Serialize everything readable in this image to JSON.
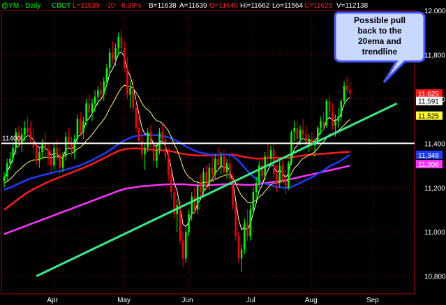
{
  "header": {
    "symbol": "@YM - Daily",
    "exchange": "CBOT",
    "last": "L=11639",
    "change": "-10",
    "change_pct": "-0.09%",
    "bid": "B=11638",
    "ask": "A=11639",
    "open": "O=11640",
    "high": "Hi=11662",
    "low": "Lo=11564",
    "close": "C=11625",
    "volume": "V=112138"
  },
  "colors": {
    "background": "#000000",
    "up_candle": "#00ff00",
    "down_candle": "#ff0000",
    "ema_fast": "#ffffff",
    "ema_20": "#ffff66",
    "ma_blue": "#1e3cff",
    "ma_red": "#ff1a1a",
    "ma_magenta": "#ff33ff",
    "trendline": "#33ee88",
    "horizontal": "#ffffff",
    "callout_fill": "#c9d8ff",
    "callout_border": "#5566ff",
    "grid": "#b00000"
  },
  "chart_data": {
    "type": "candlestick",
    "y_axis": {
      "min": 10720,
      "max": 12000,
      "ticks": [
        "12,000",
        "11,800",
        "11,600",
        "11,400",
        "11,200",
        "11,000",
        "10,800"
      ],
      "tick_values": [
        12000,
        11800,
        11600,
        11400,
        11200,
        11000,
        10800
      ]
    },
    "x_axis": {
      "labels": [
        "Apr",
        "May",
        "Jun",
        "Jul",
        "Aug",
        "Sep"
      ],
      "label_index": [
        17,
        41,
        63,
        85,
        105,
        126
      ]
    },
    "grid": true,
    "candles": [
      [
        11230,
        11270,
        11200,
        11250
      ],
      [
        11250,
        11330,
        11230,
        11310
      ],
      [
        11310,
        11360,
        11280,
        11330
      ],
      [
        11330,
        11400,
        11310,
        11380
      ],
      [
        11380,
        11470,
        11350,
        11450
      ],
      [
        11450,
        11480,
        11380,
        11400
      ],
      [
        11400,
        11470,
        11360,
        11440
      ],
      [
        11440,
        11500,
        11410,
        11470
      ],
      [
        11470,
        11520,
        11430,
        11450
      ],
      [
        11450,
        11500,
        11400,
        11420
      ],
      [
        11420,
        11470,
        11350,
        11380
      ],
      [
        11380,
        11400,
        11300,
        11320
      ],
      [
        11320,
        11380,
        11290,
        11360
      ],
      [
        11360,
        11420,
        11330,
        11400
      ],
      [
        11400,
        11450,
        11340,
        11370
      ],
      [
        11370,
        11400,
        11300,
        11330
      ],
      [
        11330,
        11370,
        11270,
        11300
      ],
      [
        11300,
        11400,
        11280,
        11380
      ],
      [
        11380,
        11420,
        11320,
        11350
      ],
      [
        11350,
        11380,
        11260,
        11290
      ],
      [
        11290,
        11360,
        11270,
        11340
      ],
      [
        11340,
        11450,
        11320,
        11430
      ],
      [
        11430,
        11470,
        11380,
        11400
      ],
      [
        11400,
        11430,
        11340,
        11360
      ],
      [
        11360,
        11440,
        11330,
        11420
      ],
      [
        11420,
        11530,
        11400,
        11510
      ],
      [
        11510,
        11540,
        11430,
        11450
      ],
      [
        11450,
        11520,
        11420,
        11500
      ],
      [
        11500,
        11600,
        11480,
        11580
      ],
      [
        11580,
        11620,
        11520,
        11540
      ],
      [
        11540,
        11600,
        11500,
        11580
      ],
      [
        11580,
        11640,
        11540,
        11610
      ],
      [
        11610,
        11660,
        11570,
        11640
      ],
      [
        11640,
        11680,
        11600,
        11620
      ],
      [
        11620,
        11700,
        11590,
        11680
      ],
      [
        11680,
        11760,
        11660,
        11740
      ],
      [
        11740,
        11830,
        11720,
        11810
      ],
      [
        11810,
        11860,
        11760,
        11780
      ],
      [
        11780,
        11850,
        11750,
        11830
      ],
      [
        11830,
        11900,
        11800,
        11880
      ],
      [
        11880,
        11910,
        11810,
        11830
      ],
      [
        11830,
        11860,
        11720,
        11740
      ],
      [
        11740,
        11790,
        11600,
        11620
      ],
      [
        11620,
        11680,
        11560,
        11650
      ],
      [
        11650,
        11690,
        11540,
        11560
      ],
      [
        11560,
        11600,
        11450,
        11470
      ],
      [
        11470,
        11530,
        11390,
        11410
      ],
      [
        11410,
        11460,
        11320,
        11350
      ],
      [
        11350,
        11400,
        11280,
        11380
      ],
      [
        11380,
        11470,
        11360,
        11450
      ],
      [
        11450,
        11480,
        11380,
        11400
      ],
      [
        11400,
        11420,
        11300,
        11320
      ],
      [
        11320,
        11400,
        11290,
        11370
      ],
      [
        11370,
        11470,
        11350,
        11450
      ],
      [
        11450,
        11490,
        11400,
        11420
      ],
      [
        11420,
        11440,
        11320,
        11340
      ],
      [
        11340,
        11380,
        11230,
        11260
      ],
      [
        11260,
        11300,
        11150,
        11180
      ],
      [
        11180,
        11200,
        11060,
        11080
      ],
      [
        11080,
        11150,
        11000,
        11120
      ],
      [
        11120,
        11140,
        10940,
        10960
      ],
      [
        10960,
        11000,
        10840,
        10880
      ],
      [
        10880,
        11020,
        10860,
        11000
      ],
      [
        11000,
        11100,
        10980,
        11080
      ],
      [
        11080,
        11180,
        11050,
        11160
      ],
      [
        11160,
        11200,
        11080,
        11100
      ],
      [
        11100,
        11230,
        11080,
        11210
      ],
      [
        11210,
        11260,
        11160,
        11180
      ],
      [
        11180,
        11290,
        11160,
        11270
      ],
      [
        11270,
        11300,
        11190,
        11210
      ],
      [
        11210,
        11310,
        11190,
        11290
      ],
      [
        11290,
        11340,
        11240,
        11260
      ],
      [
        11260,
        11350,
        11240,
        11330
      ],
      [
        11330,
        11380,
        11280,
        11300
      ],
      [
        11300,
        11360,
        11260,
        11340
      ],
      [
        11340,
        11370,
        11250,
        11270
      ],
      [
        11270,
        11330,
        11240,
        11310
      ],
      [
        11310,
        11350,
        11220,
        11240
      ],
      [
        11240,
        11260,
        11100,
        11120
      ],
      [
        11120,
        11130,
        10960,
        10980
      ],
      [
        10980,
        11000,
        10860,
        10880
      ],
      [
        10880,
        10940,
        10820,
        10920
      ],
      [
        10920,
        11060,
        10900,
        11040
      ],
      [
        11040,
        11100,
        10960,
        10980
      ],
      [
        10980,
        11120,
        10960,
        11100
      ],
      [
        11100,
        11200,
        11080,
        11180
      ],
      [
        11180,
        11250,
        11140,
        11220
      ],
      [
        11220,
        11320,
        11200,
        11300
      ],
      [
        11300,
        11340,
        11220,
        11250
      ],
      [
        11250,
        11360,
        11230,
        11340
      ],
      [
        11340,
        11400,
        11300,
        11330
      ],
      [
        11330,
        11390,
        11290,
        11370
      ],
      [
        11370,
        11400,
        11240,
        11260
      ],
      [
        11260,
        11300,
        11180,
        11220
      ],
      [
        11220,
        11320,
        11200,
        11300
      ],
      [
        11300,
        11340,
        11220,
        11240
      ],
      [
        11240,
        11280,
        11170,
        11200
      ],
      [
        11200,
        11320,
        11190,
        11310
      ],
      [
        11310,
        11460,
        11300,
        11450
      ],
      [
        11450,
        11500,
        11410,
        11470
      ],
      [
        11470,
        11500,
        11380,
        11420
      ],
      [
        11420,
        11480,
        11390,
        11460
      ],
      [
        11460,
        11510,
        11420,
        11440
      ],
      [
        11440,
        11480,
        11380,
        11400
      ],
      [
        11400,
        11440,
        11360,
        11420
      ],
      [
        11420,
        11450,
        11370,
        11390
      ],
      [
        11390,
        11420,
        11340,
        11410
      ],
      [
        11410,
        11480,
        11390,
        11470
      ],
      [
        11470,
        11520,
        11440,
        11500
      ],
      [
        11500,
        11540,
        11460,
        11480
      ],
      [
        11480,
        11600,
        11470,
        11590
      ],
      [
        11590,
        11620,
        11520,
        11540
      ],
      [
        11540,
        11580,
        11460,
        11480
      ],
      [
        11480,
        11530,
        11430,
        11500
      ],
      [
        11500,
        11560,
        11470,
        11520
      ],
      [
        11520,
        11600,
        11500,
        11590
      ],
      [
        11590,
        11680,
        11570,
        11660
      ],
      [
        11660,
        11700,
        11620,
        11640
      ],
      [
        11640,
        11680,
        11600,
        11625
      ]
    ],
    "ema_fast": [
      11240,
      11270,
      11300,
      11330,
      11380,
      11390,
      11405,
      11425,
      11435,
      11430,
      11415,
      11390,
      11380,
      11385,
      11380,
      11365,
      11345,
      11355,
      11352,
      11335,
      11337,
      11370,
      11380,
      11373,
      11388,
      11430,
      11437,
      11458,
      11500,
      11513,
      11535,
      11560,
      11587,
      11598,
      11626,
      11664,
      11713,
      11736,
      11767,
      11805,
      11813,
      11789,
      11733,
      11705,
      11657,
      11594,
      11533,
      11472,
      11441,
      11444,
      11429,
      11393,
      11385,
      11406,
      11411,
      11387,
      11345,
      11290,
      11220,
      11187,
      11112,
      11035,
      11024,
      11043,
      11082,
      11088,
      11129,
      11146,
      11187,
      11195,
      11226,
      11237,
      11268,
      11279,
      11299,
      11289,
      11296,
      11277,
      11225,
      11143,
      11055,
      11010,
      11020,
      11007,
      11038,
      11085,
      11130,
      11187,
      11208,
      11252,
      11278,
      11309,
      11293,
      11269,
      11279,
      11266,
      11244,
      11266,
      11328,
      11375,
      11390,
      11413,
      11422,
      11415,
      11417,
      11408,
      11409,
      11429,
      11453,
      11462,
      11505,
      11517,
      11505,
      11503,
      11509,
      11536,
      11577,
      11598,
      11607
    ],
    "ema_20": [
      11220,
      11228,
      11238,
      11250,
      11267,
      11278,
      11290,
      11303,
      11313,
      11320,
      11325,
      11325,
      11328,
      11334,
      11337,
      11337,
      11334,
      11339,
      11340,
      11336,
      11337,
      11347,
      11353,
      11355,
      11362,
      11375,
      11382,
      11394,
      11412,
      11425,
      11440,
      11457,
      11475,
      11490,
      11508,
      11530,
      11557,
      11579,
      11603,
      11629,
      11650,
      11662,
      11658,
      11657,
      11649,
      11630,
      11608,
      11582,
      11562,
      11552,
      11538,
      11517,
      11503,
      11498,
      11490,
      11475,
      11456,
      11429,
      11396,
      11371,
      11335,
      11292,
      11264,
      11247,
      11239,
      11226,
      11225,
      11219,
      11224,
      11222,
      11228,
      11230,
      11238,
      11242,
      11251,
      11253,
      11259,
      11256,
      11245,
      11220,
      11187,
      11163,
      11150,
      11134,
      11130,
      11135,
      11143,
      11158,
      11167,
      11184,
      11198,
      11214,
      11218,
      11219,
      11228,
      11229,
      11227,
      11238,
      11263,
      11288,
      11300,
      11318,
      11332,
      11338,
      11348,
      11353,
      11362,
      11376,
      11393,
      11406,
      11423,
      11440,
      11443,
      11450,
      11457,
      11469,
      11482,
      11496,
      11508
    ],
    "ma_blue": [
      11190,
      11195,
      11200,
      11205,
      11212,
      11218,
      11224,
      11230,
      11236,
      11241,
      11245,
      11248,
      11252,
      11256,
      11259,
      11262,
      11265,
      11269,
      11272,
      11274,
      11277,
      11281,
      11285,
      11288,
      11292,
      11297,
      11301,
      11306,
      11312,
      11318,
      11324,
      11331,
      11338,
      11345,
      11352,
      11360,
      11369,
      11377,
      11386,
      11396,
      11405,
      11413,
      11419,
      11425,
      11430,
      11433,
      11435,
      11436,
      11437,
      11438,
      11438,
      11437,
      11436,
      11435,
      11433,
      11430,
      11427,
      11422,
      11416,
      11410,
      11403,
      11394,
      11386,
      11379,
      11373,
      11367,
      11362,
      11358,
      11355,
      11352,
      11350,
      11349,
      11349,
      11349,
      11350,
      11350,
      11349,
      11347,
      11342,
      11333,
      11320,
      11305,
      11290,
      11275,
      11262,
      11250,
      11240,
      11232,
      11224,
      11218,
      11214,
      11211,
      11207,
      11203,
      11202,
      11200,
      11198,
      11199,
      11203,
      11209,
      11214,
      11221,
      11228,
      11234,
      11241,
      11247,
      11254,
      11262,
      11270,
      11278,
      11287,
      11296,
      11302,
      11309,
      11315,
      11323,
      11331,
      11340,
      11348
    ],
    "ma_red": [
      11100,
      11110,
      11120,
      11130,
      11140,
      11150,
      11160,
      11170,
      11178,
      11186,
      11193,
      11200,
      11206,
      11213,
      11220,
      11226,
      11231,
      11237,
      11242,
      11247,
      11252,
      11258,
      11263,
      11268,
      11273,
      11279,
      11284,
      11289,
      11295,
      11301,
      11307,
      11313,
      11320,
      11326,
      11332,
      11339,
      11346,
      11353,
      11359,
      11365,
      11370,
      11373,
      11375,
      11376,
      11377,
      11377,
      11376,
      11375,
      11374,
      11373,
      11372,
      11371,
      11370,
      11369,
      11368,
      11367,
      11366,
      11364,
      11361,
      11358,
      11355,
      11352,
      11350,
      11348,
      11347,
      11346,
      11345,
      11345,
      11345,
      11345,
      11345,
      11346,
      11346,
      11347,
      11348,
      11349,
      11350,
      11350,
      11349,
      11347,
      11344,
      11341,
      11338,
      11336,
      11334,
      11332,
      11331,
      11331,
      11331,
      11332,
      11333,
      11334,
      11334,
      11334,
      11334,
      11334,
      11334,
      11334,
      11336,
      11339,
      11341,
      11343,
      11345,
      11346,
      11348,
      11349,
      11350,
      11351,
      11352,
      11353,
      11354,
      11355,
      11356,
      11357,
      11358,
      11359,
      11360,
      11361,
      11362
    ],
    "ma_magenta": [
      10990,
      10995,
      11000,
      11005,
      11010,
      11015,
      11020,
      11025,
      11030,
      11035,
      11040,
      11045,
      11050,
      11055,
      11060,
      11065,
      11070,
      11075,
      11080,
      11085,
      11090,
      11095,
      11100,
      11105,
      11110,
      11115,
      11120,
      11125,
      11130,
      11135,
      11140,
      11145,
      11150,
      11155,
      11160,
      11165,
      11170,
      11175,
      11180,
      11185,
      11189,
      11193,
      11196,
      11198,
      11200,
      11202,
      11204,
      11206,
      11207,
      11208,
      11209,
      11210,
      11211,
      11212,
      11213,
      11214,
      11215,
      11215,
      11215,
      11215,
      11215,
      11215,
      11214,
      11213,
      11212,
      11211,
      11210,
      11210,
      11210,
      11210,
      11210,
      11211,
      11212,
      11213,
      11214,
      11215,
      11216,
      11216,
      11216,
      11215,
      11214,
      11213,
      11212,
      11212,
      11212,
      11213,
      11214,
      11216,
      11218,
      11220,
      11222,
      11224,
      11226,
      11228,
      11230,
      11232,
      11234,
      11236,
      11239,
      11242,
      11245,
      11248,
      11251,
      11254,
      11257,
      11260,
      11263,
      11266,
      11269,
      11272,
      11275,
      11278,
      11281,
      11284,
      11287,
      11290,
      11293,
      11296,
      11299
    ],
    "horizontal_line": {
      "value": 11400,
      "label": "11400"
    },
    "trendline": {
      "from": [
        11,
        10800
      ],
      "to": [
        134,
        11580
      ]
    },
    "price_badges": [
      {
        "text": "11,625",
        "value": 11625,
        "bg": "#ff1a1a",
        "fg": "#ffffff"
      },
      {
        "text": "11,591",
        "value": 11591,
        "bg": "#ffffff",
        "fg": "#000000"
      },
      {
        "text": "11,525",
        "value": 11525,
        "bg": "#ffff33",
        "fg": "#000000"
      },
      {
        "text": "11,348",
        "value": 11348,
        "bg": "#1e3cff",
        "fg": "#ffffff"
      },
      {
        "text": "11,306",
        "value": 11306,
        "bg": "#ff33ff",
        "fg": "#ffffff"
      }
    ]
  },
  "callout": {
    "text_lines": [
      "Possible pull",
      "back to the",
      "20ema and",
      "trendline"
    ]
  }
}
